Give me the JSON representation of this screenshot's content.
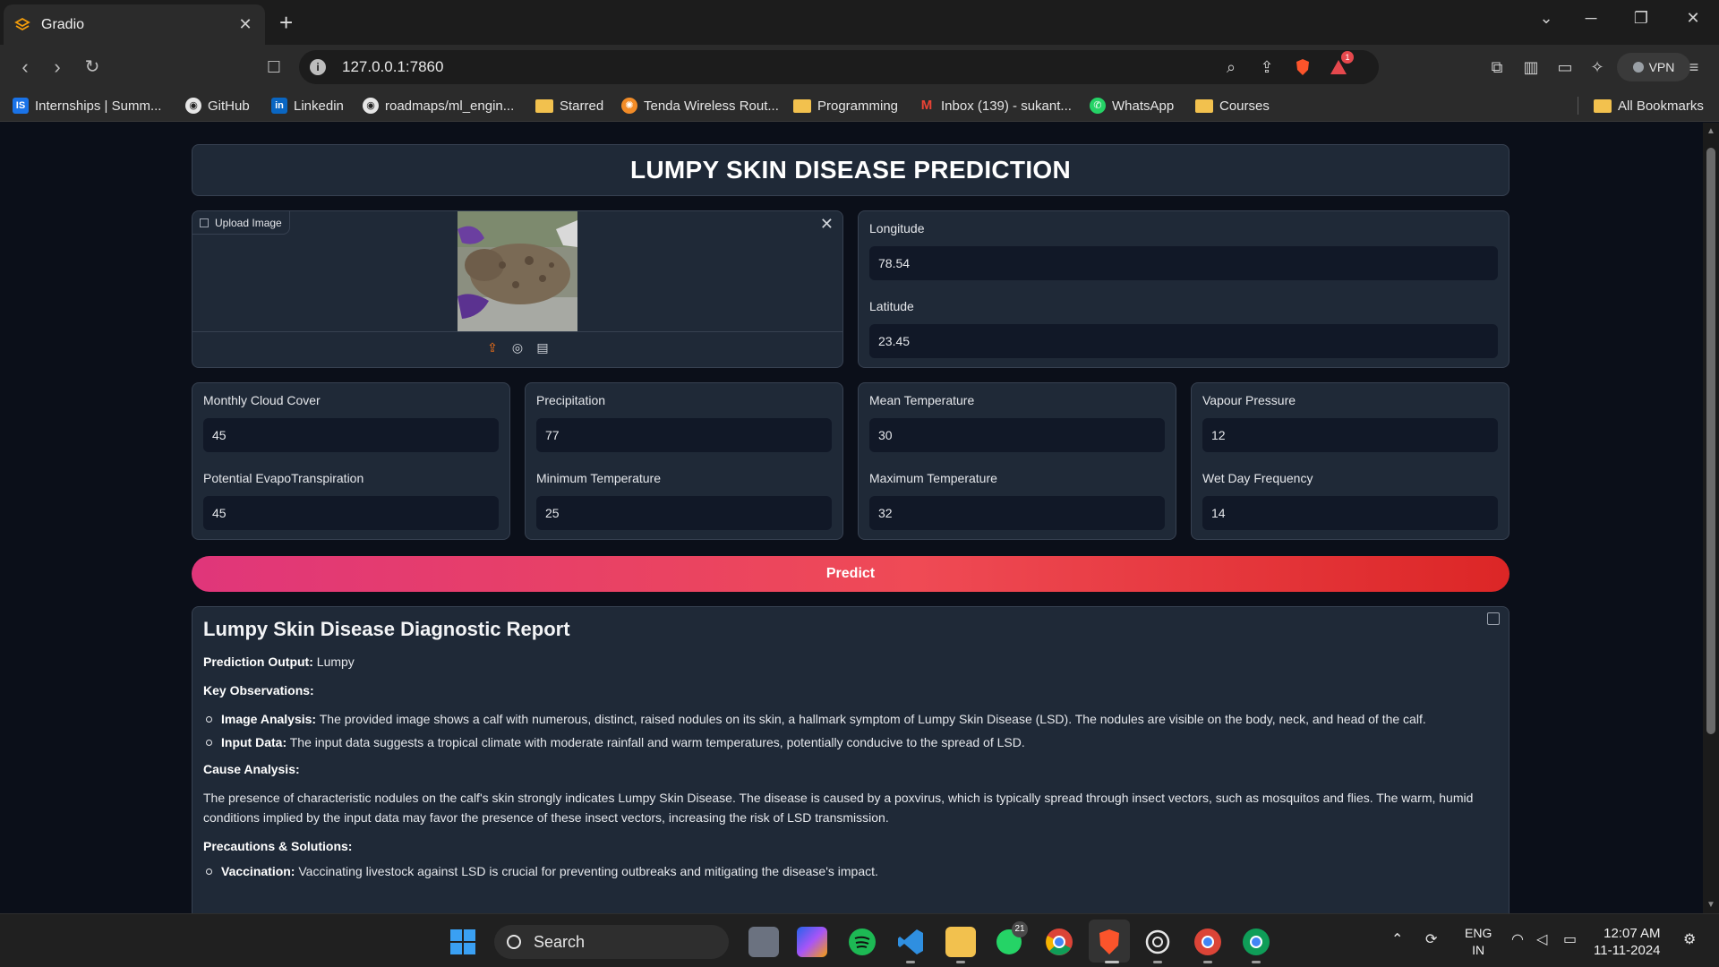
{
  "browser": {
    "tab_title": "Gradio",
    "url": "127.0.0.1:7860",
    "vpn_label": "VPN",
    "notification_count": "1",
    "bookmarks": [
      "Internships | Summ...",
      "GitHub",
      "Linkedin",
      "roadmaps/ml_engin...",
      "Starred",
      "Tenda Wireless Rout...",
      "Programming",
      "Inbox (139) - sukant...",
      "WhatsApp",
      "Courses"
    ],
    "all_bookmarks": "All Bookmarks"
  },
  "app": {
    "title": "LUMPY SKIN DISEASE PREDICTION",
    "image_input": {
      "label": "Upload Image"
    },
    "fields": {
      "longitude": {
        "label": "Longitude",
        "value": "78.54"
      },
      "latitude": {
        "label": "Latitude",
        "value": "23.45"
      },
      "cloud_cover": {
        "label": "Monthly Cloud Cover",
        "value": "45"
      },
      "pet": {
        "label": "Potential EvapoTranspiration",
        "value": "45"
      },
      "precipitation": {
        "label": "Precipitation",
        "value": "77"
      },
      "min_temp": {
        "label": "Minimum Temperature",
        "value": "25"
      },
      "mean_temp": {
        "label": "Mean Temperature",
        "value": "30"
      },
      "max_temp": {
        "label": "Maximum Temperature",
        "value": "32"
      },
      "vapour_pressure": {
        "label": "Vapour Pressure",
        "value": "12"
      },
      "wet_day_freq": {
        "label": "Wet Day Frequency",
        "value": "14"
      }
    },
    "predict_label": "Predict",
    "report": {
      "title": "Lumpy Skin Disease Diagnostic Report",
      "prediction_label": "Prediction Output:",
      "prediction_value": "Lumpy",
      "key_obs_heading": "Key Observations:",
      "obs_image_label": "Image Analysis:",
      "obs_image_text": "The provided image shows a calf with numerous, distinct, raised nodules on its skin, a hallmark symptom of Lumpy Skin Disease (LSD). The nodules are visible on the body, neck, and head of the calf.",
      "obs_input_label": "Input Data:",
      "obs_input_text": "The input data suggests a tropical climate with moderate rainfall and warm temperatures, potentially conducive to the spread of LSD.",
      "cause_heading": "Cause Analysis:",
      "cause_text": "The presence of characteristic nodules on the calf's skin strongly indicates Lumpy Skin Disease. The disease is caused by a poxvirus, which is typically spread through insect vectors, such as mosquitos and flies. The warm, humid conditions implied by the input data may favor the presence of these insect vectors, increasing the risk of LSD transmission.",
      "precautions_heading": "Precautions & Solutions:",
      "vacc_label": "Vaccination:",
      "vacc_text": "Vaccinating livestock against LSD is crucial for preventing outbreaks and mitigating the disease's impact."
    }
  },
  "taskbar": {
    "search_label": "Search",
    "whatsapp_badge": "21",
    "lang_top": "ENG",
    "lang_bottom": "IN",
    "time": "12:07 AM",
    "date": "11-11-2024"
  }
}
